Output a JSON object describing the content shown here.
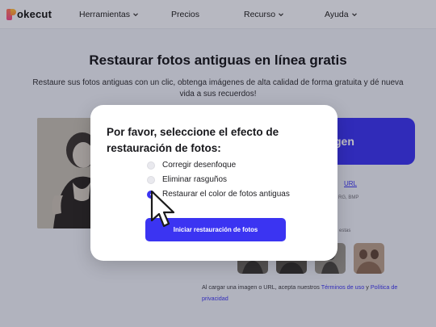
{
  "header": {
    "logo_text": "okecut",
    "nav": [
      {
        "label": "Herramientas",
        "has_dropdown": true
      },
      {
        "label": "Precios",
        "has_dropdown": false
      },
      {
        "label": "Recurso",
        "has_dropdown": true
      },
      {
        "label": "Ayuda",
        "has_dropdown": true
      }
    ]
  },
  "main": {
    "title": "Restaurar fotos antiguas en línea gratis",
    "subtitle": "Restaure sus fotos antiguas con un clic, obtenga imágenes de alta calidad de forma gratuita y dé nueva vida a sus recuerdos!",
    "upload_button_label": "gen",
    "url_link": "URL",
    "formats_text": "RG, BMP",
    "samples_label": "estas",
    "terms": {
      "prefix": "Al cargar una imagen o URL, acepta nuestros",
      "terms_link": "Términos de uso",
      "conjunction": "y",
      "privacy_link": "Política de privacidad"
    }
  },
  "modal": {
    "title": "Por favor, seleccione el efecto de restauración de fotos:",
    "options": [
      {
        "label": "Corregir desenfoque",
        "checked": false
      },
      {
        "label": "Eliminar rasguños",
        "checked": false
      },
      {
        "label": "Restaurar el color de fotos antiguas",
        "checked": true
      }
    ],
    "start_button_label": "Iniciar restauración de fotos"
  },
  "colors": {
    "accent": "#3b34f2",
    "overlay": "rgba(20,22,40,0.28)",
    "page_bg": "#eef0f8"
  },
  "icons": [
    "pokecut-logo-icon",
    "chevron-down-icon",
    "mouse-pointer-icon"
  ]
}
